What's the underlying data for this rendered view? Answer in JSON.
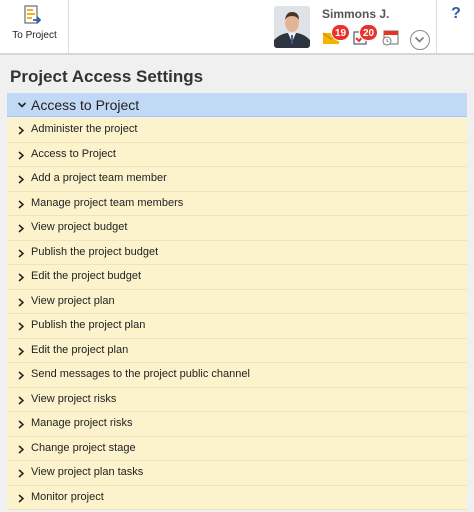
{
  "toolbar": {
    "to_project_label": "To Project",
    "to_project_icon": "document-arrow-icon"
  },
  "user": {
    "name": "Simmons J.",
    "avatar_icon": "avatar"
  },
  "notifications": {
    "messages_count": "19",
    "tasks_count": "20",
    "messages_icon": "envelope-icon",
    "tasks_icon": "checkbox-icon",
    "calendar_icon": "calendar-icon",
    "accent": "#e8332b"
  },
  "help": {
    "label": "?"
  },
  "page": {
    "title": "Project Access Settings"
  },
  "section": {
    "title": "Access to Project",
    "header_color": "#c2d9f5",
    "item_color": "#fcf2cc",
    "items": [
      "Administer the project",
      "Access to Project",
      "Add a project team member",
      "Manage project team members",
      "View project budget",
      "Publish the project budget",
      "Edit the project budget",
      "View project plan",
      "Publish the project plan",
      "Edit the project plan",
      "Send messages to the project public channel",
      "View project risks",
      "Manage project risks",
      "Change project stage",
      "View project plan tasks",
      "Monitor project"
    ]
  }
}
